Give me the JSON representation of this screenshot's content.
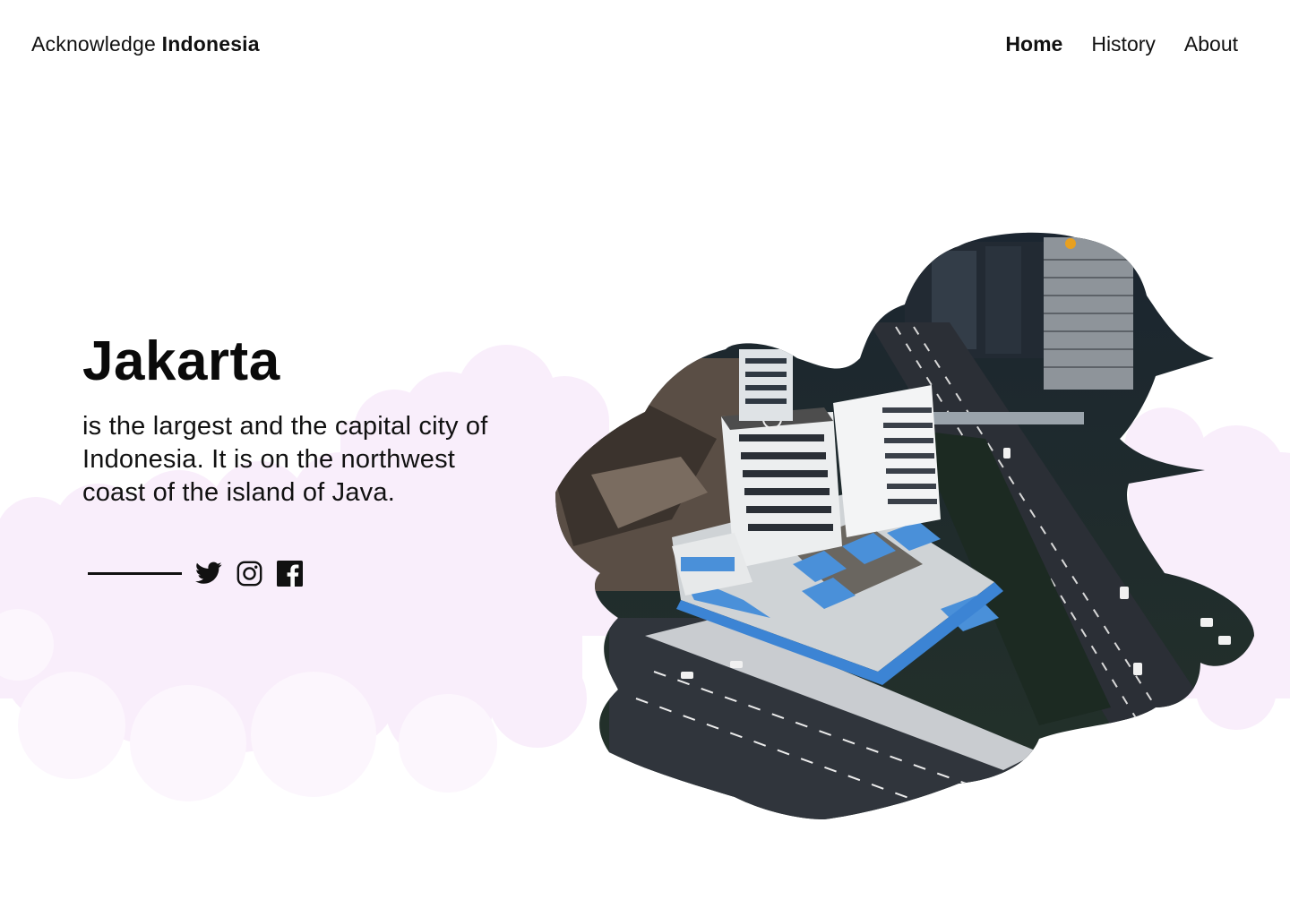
{
  "header": {
    "brand_light": "Acknowledge",
    "brand_bold": "Indonesia",
    "nav": [
      {
        "label": "Home",
        "active": true
      },
      {
        "label": "History",
        "active": false
      },
      {
        "label": "About",
        "active": false
      }
    ]
  },
  "hero": {
    "title": "Jakarta",
    "description": "is the largest and the capital city of Indonesia. It is on the northwest coast of the island of Java."
  },
  "social": {
    "icons": [
      "twitter-icon",
      "instagram-icon",
      "facebook-icon"
    ]
  },
  "colors": {
    "cloud": "#f9eefb",
    "text": "#111111",
    "building_blue": "#4a90d9",
    "road": "#2b2f36",
    "foliage": "#1c2a22"
  }
}
